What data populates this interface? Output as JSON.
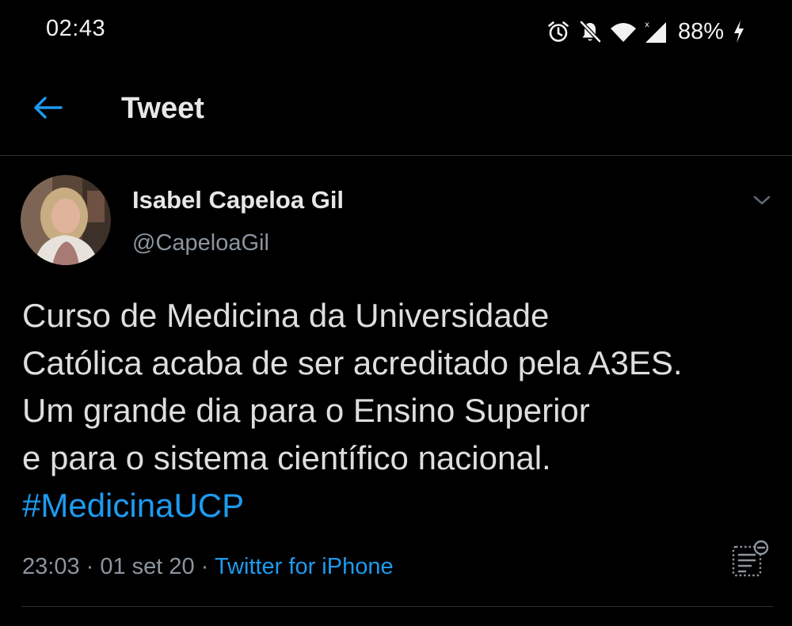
{
  "status_bar": {
    "time": "02:43",
    "battery": "88%",
    "icons": [
      "alarm-icon",
      "notifications-off-icon",
      "wifi-icon",
      "cell-signal-icon",
      "charging-icon"
    ]
  },
  "header": {
    "title": "Tweet",
    "back_icon": "back-arrow-icon"
  },
  "tweet": {
    "author": {
      "name": "Isabel Capeloa Gil",
      "handle": "@CapeloaGil"
    },
    "text_lines": [
      "Curso de Medicina da Universidade",
      "Católica acaba de ser acreditado pela A3ES.",
      "Um grande dia para o Ensino Superior",
      "e para o sistema científico nacional."
    ],
    "hashtag": "#MedicinaUCP",
    "meta": {
      "time": "23:03",
      "separator": " · ",
      "date": "01 set 20",
      "source": "Twitter for iPhone"
    }
  },
  "colors": {
    "background": "#000000",
    "accent": "#1d9bf0",
    "muted": "#8b959e",
    "divider": "#2f3336"
  }
}
